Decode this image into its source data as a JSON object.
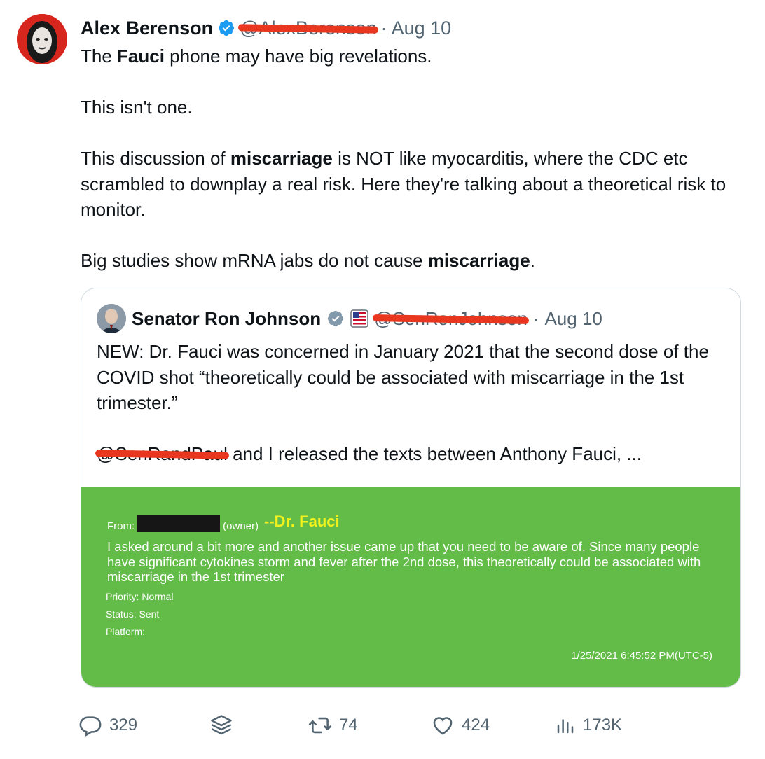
{
  "tweet": {
    "author_name": "Alex Berenson",
    "handle": "@AlexBerenson",
    "dot": "·",
    "time": "Aug 10",
    "lines": {
      "l1_pre": "The ",
      "l1_bold": "Fauci",
      "l1_post": " phone may have big revelations.",
      "l2": "This isn't one.",
      "l3_pre": "This discussion of ",
      "l3_bold": "miscarriage",
      "l3_post": " is NOT like myocarditis, where the CDC etc scrambled to downplay a real risk. Here they're talking about a theoretical risk to monitor.",
      "l4_pre": "Big studies show mRNA jabs do not cause ",
      "l4_bold": "miscarriage",
      "l4_post": "."
    }
  },
  "quote": {
    "author_name": "Senator Ron Johnson",
    "handle": "@SenRonJohnson",
    "dot": "·",
    "time": "Aug 10",
    "p1": "NEW: Dr. Fauci was concerned in January 2021 that the second dose of the COVID shot “theoretically could be associated with miscarriage in the 1st trimester.”",
    "mention": "@SenRandPaul",
    "p2": " and I released the texts between Anthony Fauci, ...",
    "media": {
      "from_label": "From:",
      "owner_label": "(owner)",
      "name_label": "--Dr. Fauci",
      "message": "I asked around a bit more and another issue came up that you need to be aware of.  Since many people have significant cytokines storm and fever after the 2nd dose, this theoretically could be associated with miscarriage in the 1st trimester",
      "priority": "Priority: Normal",
      "status": "Status: Sent",
      "platform": "Platform:",
      "timestamp": "1/25/2021 6:45:52 PM(UTC-5)"
    }
  },
  "actions": {
    "replies": "329",
    "retweets": "74",
    "likes": "424",
    "views": "173K"
  },
  "colors": {
    "verified": "#1d9bf0",
    "redaction": "#e8361f",
    "media_bg": "#62bc47",
    "muted": "#536471"
  }
}
